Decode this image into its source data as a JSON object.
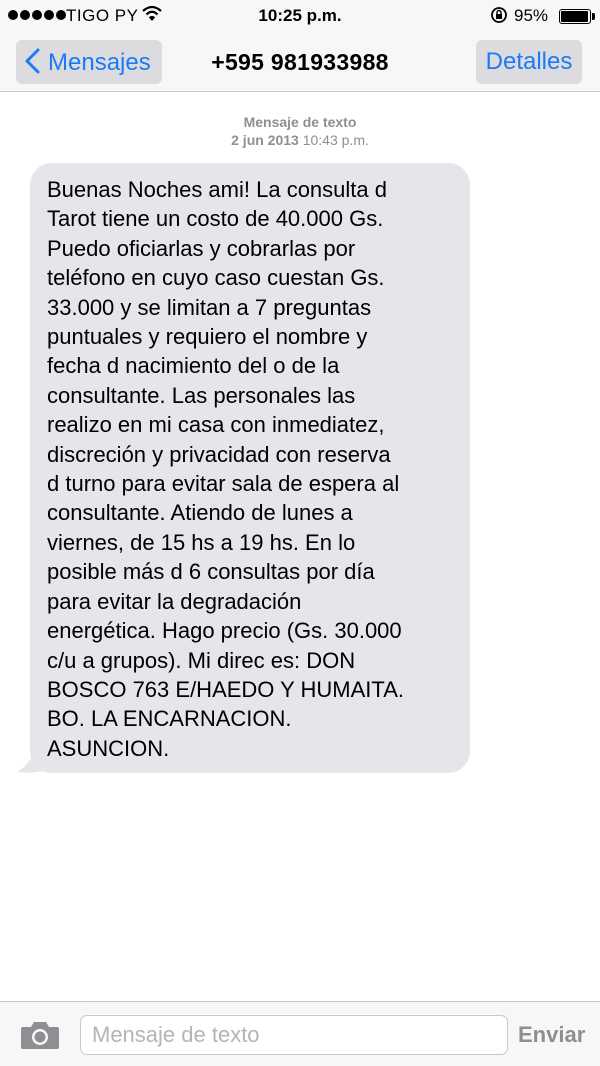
{
  "status_bar": {
    "carrier": "TIGO PY",
    "time": "10:25 p.m.",
    "battery_percent": "95%",
    "battery_level": 0.95,
    "icons": [
      "signal-dots-icon",
      "wifi-icon",
      "rotation-lock-icon",
      "battery-icon"
    ]
  },
  "nav": {
    "back_label": "Mensajes",
    "title": "+595 981933988",
    "details_label": "Detalles"
  },
  "thread": {
    "message_type": "Mensaje de texto",
    "date": "2 jun 2013",
    "time": "10:43 p.m.",
    "message_lines": [
      "Buenas Noches ami! La consulta d",
      "Tarot tiene un costo de 40.000 Gs.",
      "Puedo oficiarlas y cobrarlas por",
      "teléfono en cuyo caso cuestan Gs.",
      "33.000 y se limitan a 7 preguntas",
      "puntuales y requiero el nombre y",
      "fecha d nacimiento del o de la",
      "consultante. Las personales las",
      "realizo en mi casa con inmediatez,",
      "discreción y privacidad con reserva",
      "d turno para evitar sala de espera al",
      "consultante. Atiendo de lunes a",
      "viernes, de 15 hs a 19 hs. En lo",
      "posible más d 6 consultas por día",
      "para evitar la degradación",
      "energética. Hago precio (Gs. 30.000",
      "c/u a grupos). Mi direc es: DON",
      "BOSCO 763 E/HAEDO Y HUMAITA.",
      "BO. LA ENCARNACION.",
      "ASUNCION."
    ]
  },
  "composer": {
    "placeholder": "Mensaje de texto",
    "value": "",
    "send_label": "Enviar"
  },
  "colors": {
    "accent": "#1b7bf6",
    "bubble": "#e5e5ea",
    "bar": "#f7f7f8",
    "muted": "#8e8e93"
  }
}
